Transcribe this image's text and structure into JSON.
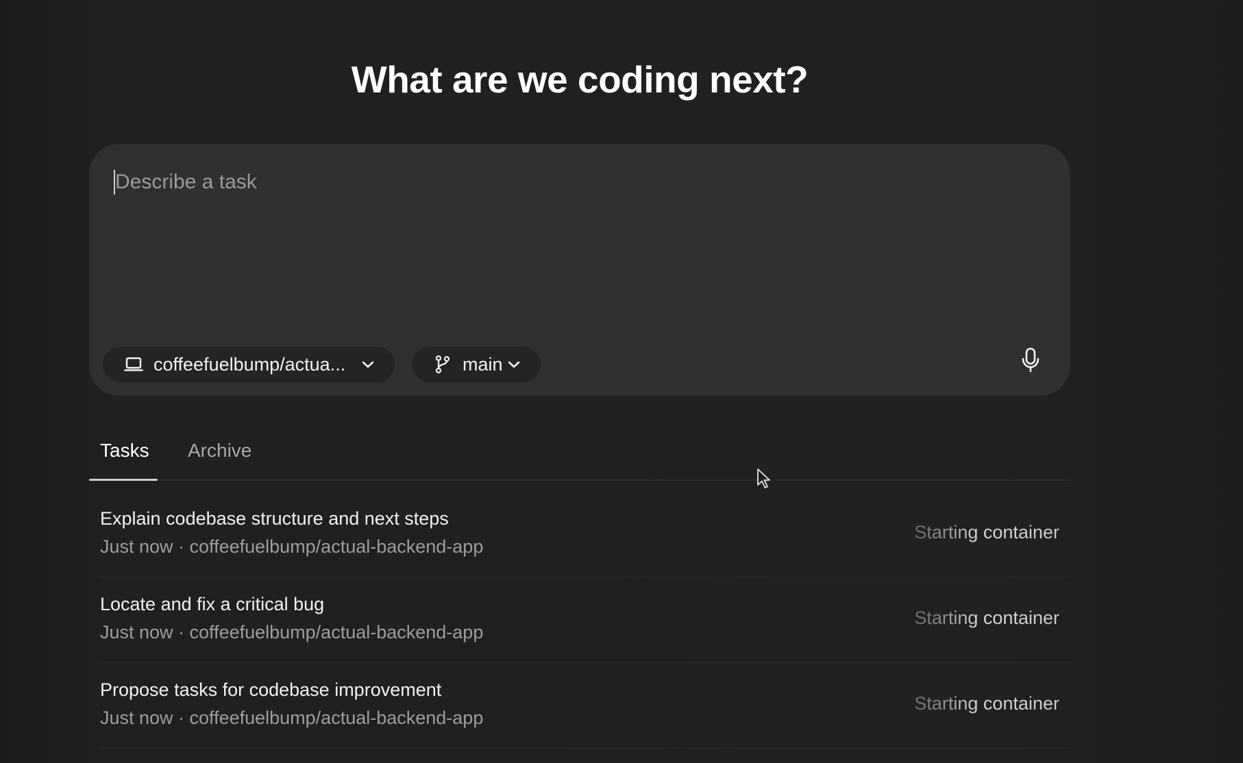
{
  "header": {
    "title": "What are we coding next?"
  },
  "composer": {
    "placeholder": "Describe a task",
    "repo_chip": {
      "icon": "laptop-icon",
      "label": "coffeefuelbump/actua..."
    },
    "branch_chip": {
      "icon": "git-branch-icon",
      "label": "main"
    },
    "mic_icon": "microphone-icon"
  },
  "tabs": [
    {
      "label": "Tasks",
      "active": true
    },
    {
      "label": "Archive",
      "active": false
    }
  ],
  "tasks": [
    {
      "title": "Explain codebase structure and next steps",
      "meta": "Just now · coffeefuelbump/actual-backend-app",
      "status": "Starting container"
    },
    {
      "title": "Locate and fix a critical bug",
      "meta": "Just now · coffeefuelbump/actual-backend-app",
      "status": "Starting container"
    },
    {
      "title": "Propose tasks for codebase improvement",
      "meta": "Just now · coffeefuelbump/actual-backend-app",
      "status": "Starting container"
    }
  ],
  "colors": {
    "background": "#1f1f1f",
    "composer": "#303030",
    "chip": "#242424",
    "text_primary": "#ffffff",
    "text_secondary": "#9d9d9d"
  }
}
